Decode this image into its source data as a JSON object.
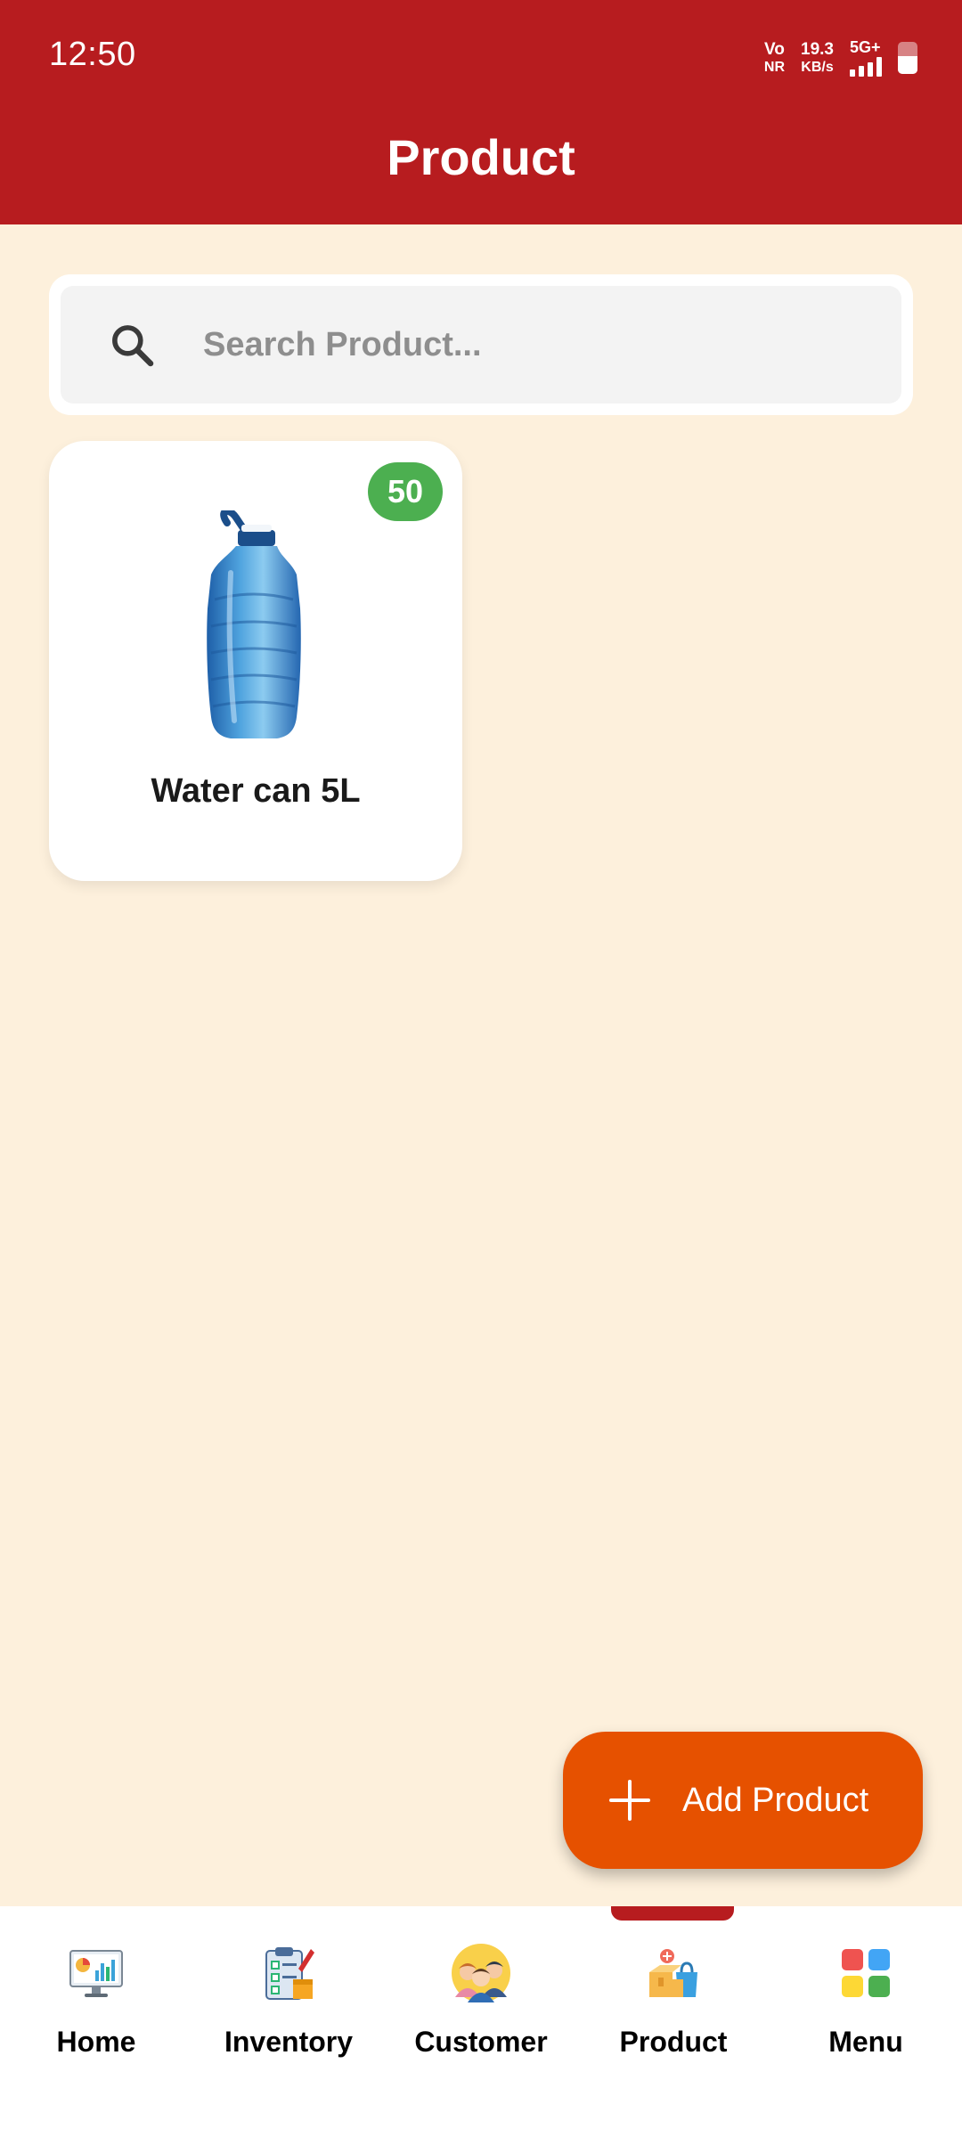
{
  "status_bar": {
    "time": "12:50",
    "volte_top": "Vo",
    "volte_bottom": "NR",
    "speed_value": "19.3",
    "speed_unit": "KB/s",
    "network": "5G+"
  },
  "header": {
    "title": "Product"
  },
  "search": {
    "placeholder": "Search Product..."
  },
  "products": [
    {
      "name": "Water can 5L",
      "stock": "50"
    }
  ],
  "fab": {
    "label": "Add Product"
  },
  "bottom_nav": {
    "items": [
      {
        "label": "Home",
        "icon": "home-dashboard-icon"
      },
      {
        "label": "Inventory",
        "icon": "inventory-clipboard-icon"
      },
      {
        "label": "Customer",
        "icon": "customer-people-icon"
      },
      {
        "label": "Product",
        "icon": "product-box-icon",
        "selected": true
      },
      {
        "label": "Menu",
        "icon": "menu-grid-icon"
      }
    ]
  },
  "colors": {
    "header": "#B71C1F",
    "background": "#FDF0DC",
    "fab": "#E65100",
    "badge": "#4CAF50"
  }
}
